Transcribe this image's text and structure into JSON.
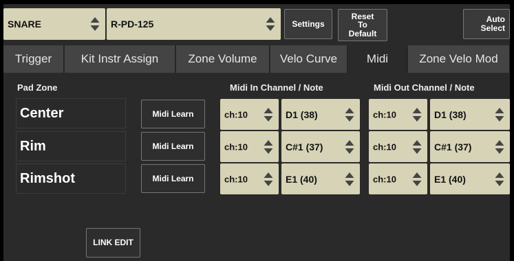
{
  "toolbar": {
    "pad": "SNARE",
    "module": "R-PD-125",
    "settings": "Settings",
    "reset_line1": "Reset",
    "reset_line2": "To",
    "reset_line3": "Default",
    "auto_line1": "Auto",
    "auto_line2": "Select"
  },
  "tabs": [
    {
      "label": "Trigger"
    },
    {
      "label": "Kit Instr Assign"
    },
    {
      "label": "Zone Volume"
    },
    {
      "label": "Velo Curve"
    },
    {
      "label": "Midi",
      "active": true
    },
    {
      "label": "Zone Velo Mod"
    }
  ],
  "headers": {
    "pad_zone": "Pad Zone",
    "midi_in": "Midi In Channel / Note",
    "midi_out": "Midi Out Channel / Note"
  },
  "rows": [
    {
      "zone": "Center",
      "learn": "Midi Learn",
      "in_ch": "ch:10",
      "in_note": "D1 (38)",
      "out_ch": "ch:10",
      "out_note": "D1 (38)"
    },
    {
      "zone": "Rim",
      "learn": "Midi Learn",
      "in_ch": "ch:10",
      "in_note": "C#1 (37)",
      "out_ch": "ch:10",
      "out_note": "C#1 (37)"
    },
    {
      "zone": "Rimshot",
      "learn": "Midi Learn",
      "in_ch": "ch:10",
      "in_note": "E1 (40)",
      "out_ch": "ch:10",
      "out_note": "E1 (40)"
    }
  ],
  "link_edit": "LINK EDIT",
  "icons": {
    "updown": "updown-arrow-icon"
  },
  "colors": {
    "selector_bg": "#d6d3b6",
    "panel_bg": "#2a2a2a",
    "tab_bg": "#444444"
  }
}
